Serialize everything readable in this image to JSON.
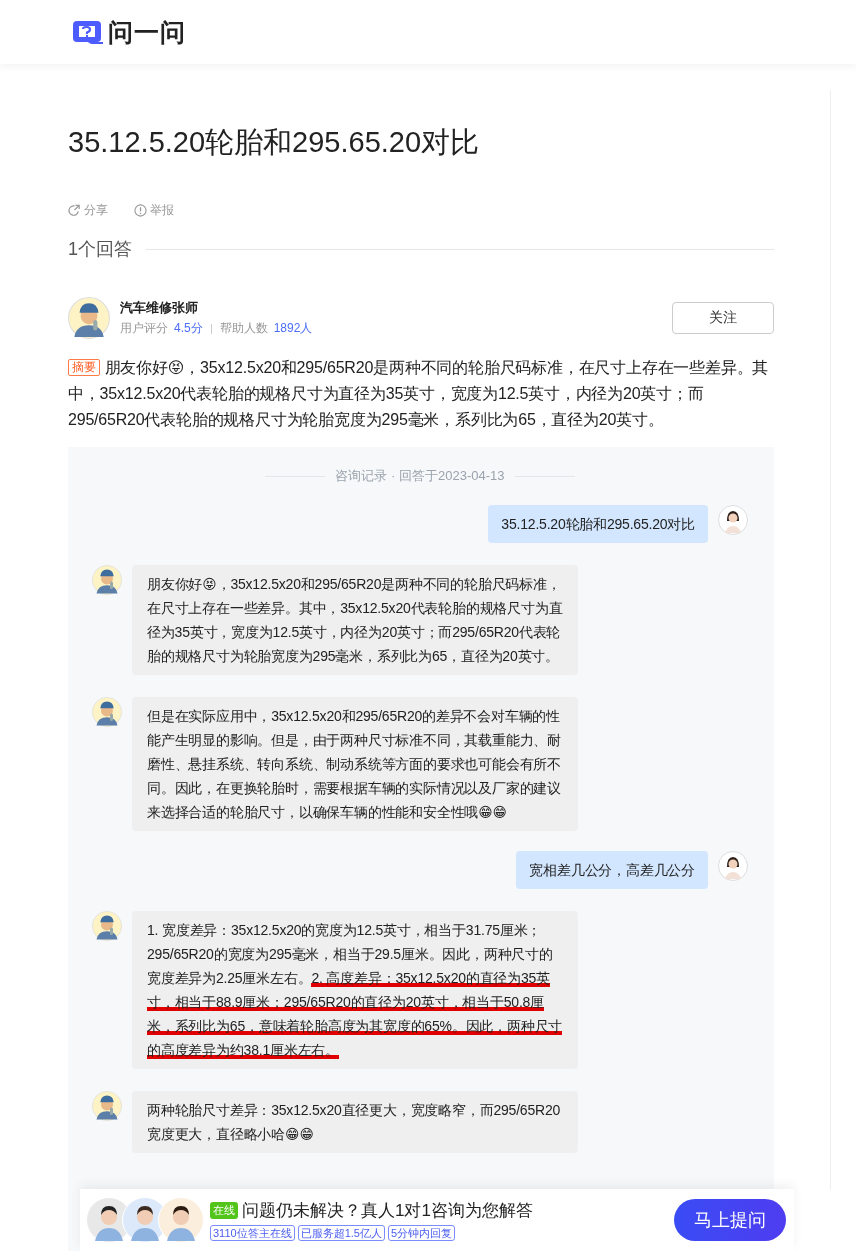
{
  "header": {
    "logo_text": "问一问"
  },
  "question": {
    "title": "35.12.5.20轮胎和295.65.20对比",
    "actions": [
      {
        "kind": "share",
        "label": "分享"
      },
      {
        "kind": "report",
        "label": "举报"
      }
    ]
  },
  "answers_heading": "1个回答",
  "answerer": {
    "name": "汽车维修张师",
    "rating_label": "用户评分",
    "rating": "4.5分",
    "helped_label": "帮助人数",
    "helped": "1892人",
    "follow_button": "关注"
  },
  "summary": {
    "tag": "摘要",
    "parts": [
      {
        "kind": "text",
        "text": "朋友你好😝，35x12.5x20和295/65R20是两种不同的轮胎尺码标准，在尺寸上存在一些差异。其中，35x12.5x20代表轮胎的规格尺寸为直径为35英寸，宽度为12.5英寸，内径为20英寸；而295/65R20代表轮胎的规格尺寸为轮胎宽度为295毫米，系列比为65，直径为20英寸。"
      }
    ]
  },
  "chat": {
    "header": "咨询记录 · 回答于2023-04-13",
    "messages": [
      {
        "kind": "user",
        "parts": [
          {
            "kind": "text",
            "text": "35.12.5.20轮胎和295.65.20对比"
          }
        ]
      },
      {
        "kind": "answer",
        "parts": [
          {
            "kind": "text",
            "text": "朋友你好😝，35x12.5x20和295/65R20是两种不同的轮胎尺码标准，在尺寸上存在一些差异。其中，35x12.5x20代表轮胎的规格尺寸为直径为35英寸，宽度为12.5英寸，内径为20英寸；而295/65R20代表轮胎的规格尺寸为轮胎宽度为295毫米，系列比为65，直径为20英寸。"
          }
        ]
      },
      {
        "kind": "answer",
        "parts": [
          {
            "kind": "text",
            "text": "但是在实际应用中，35x12.5x20和295/65R20的差异不会对车辆的性能产生明显的影响。但是，由于两种尺寸标准不同，其载重能力、耐磨性、悬挂系统、转向系统、制动系统等方面的要求也可能会有所不同。因此，在更换轮胎时，需要根据车辆的实际情况以及厂家的建议来选择合适的轮胎尺寸，以确保车辆的性能和安全性哦😁😁"
          }
        ]
      },
      {
        "kind": "user",
        "parts": [
          {
            "kind": "text",
            "text": "宽相差几公分，高差几公分"
          }
        ]
      },
      {
        "kind": "answer",
        "parts": [
          {
            "kind": "text",
            "text": "1. 宽度差异：35x12.5x20的宽度为12.5英寸，相当于31.75厘米；295/65R20的宽度为295毫米，相当于29.5厘米。因此，两种尺寸的宽度差异为2.25厘米左右。",
            "underlined": false
          },
          {
            "kind": "text",
            "text": "2. 高度差异：35x12.5x20的直径为35英寸，相当于88.9厘米；295/65R20的直径为20英寸，相当于50.8厘米，系列比为65，意味着轮胎高度为其宽度的65%。因此，两种尺寸的高度差异为约38.1厘米左右。",
            "underlined": true
          }
        ]
      },
      {
        "kind": "answer",
        "parts": [
          {
            "kind": "text",
            "text": "两种轮胎尺寸差异：35x12.5x20直径更大，宽度略窄，而295/65R20宽度更大，直径略小哈😁😁"
          }
        ]
      }
    ]
  },
  "bottom_bar": {
    "badge": "在线",
    "headline": "问题仍未解决？真人1对1咨询为您解答",
    "tags": [
      "3110位答主在线",
      "已服务超1.5亿人",
      "5分钟内回复"
    ],
    "button": "马上提问"
  }
}
